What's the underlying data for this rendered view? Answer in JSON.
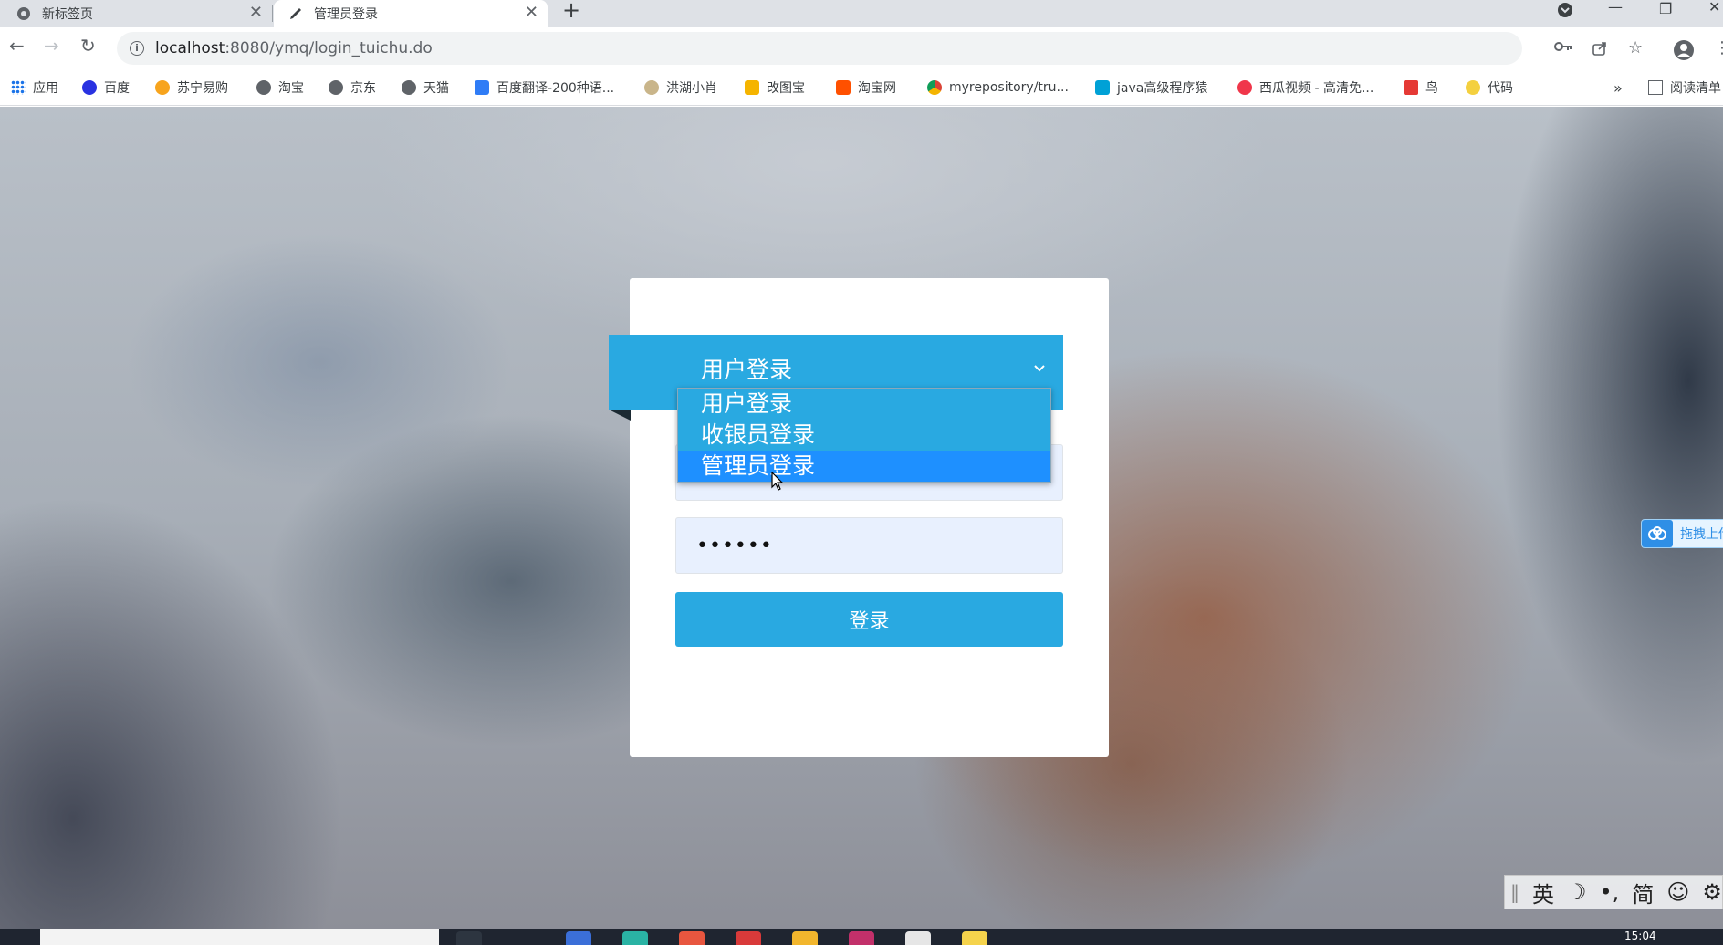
{
  "browser": {
    "tabs": [
      {
        "title": "新标签页",
        "active": false
      },
      {
        "title": "管理员登录",
        "active": true
      }
    ],
    "new_tab": "+",
    "url_host": "localhost",
    "url_path": ":8080/ymq/login_tuichu.do",
    "bookmarks": [
      {
        "label": "应用",
        "icon": "apps-grid-icon",
        "color": "#1a73e8"
      },
      {
        "label": "百度",
        "icon": "baidu-paw-icon",
        "color": "#2932e1"
      },
      {
        "label": "苏宁易购",
        "icon": "suning-icon",
        "color": "#f7a41d"
      },
      {
        "label": "淘宝",
        "icon": "globe-icon",
        "color": "#5f6368"
      },
      {
        "label": "京东",
        "icon": "globe-icon",
        "color": "#5f6368"
      },
      {
        "label": "天猫",
        "icon": "globe-icon",
        "color": "#5f6368"
      },
      {
        "label": "百度翻译-200种语...",
        "icon": "translate-icon",
        "color": "#2f7cf6"
      },
      {
        "label": "洪湖小肖",
        "icon": "feather-icon",
        "color": "#8a6d3b"
      },
      {
        "label": "改图宝",
        "icon": "folder-icon",
        "color": "#f5b400"
      },
      {
        "label": "淘宝网",
        "icon": "taobao-icon",
        "color": "#ff5000"
      },
      {
        "label": "myrepository/tru...",
        "icon": "chrome-icon",
        "color": "#db4437"
      },
      {
        "label": "java高级程序猿",
        "icon": "bilibili-icon",
        "color": "#00a1d6"
      },
      {
        "label": "西瓜视频 - 高清免...",
        "icon": "xigua-icon",
        "color": "#f0364a"
      },
      {
        "label": "鸟",
        "icon": "bird-icon",
        "color": "#e53935"
      },
      {
        "label": "代码",
        "icon": "code-icon",
        "color": "#f4d03f"
      }
    ],
    "more_bookmarks": "»",
    "reading_list": "阅读清单"
  },
  "login": {
    "select_display": "用户登录",
    "options": [
      "用户登录",
      "收银员登录",
      "管理员登录"
    ],
    "selected_index": 2,
    "password_masked": "••••••",
    "submit_label": "登录"
  },
  "baidu_widget": {
    "label": "拖拽上传"
  },
  "ime": {
    "lang": "英",
    "moon": "☽",
    "punct": "•,",
    "mode": "简",
    "emoji": "☺",
    "gear": "⚙"
  },
  "taskbar": {
    "time": "15:04"
  },
  "colors": {
    "accent": "#29a9e1",
    "dropdown_selected": "#1e90ff",
    "input_bg": "#e8f0fe"
  }
}
